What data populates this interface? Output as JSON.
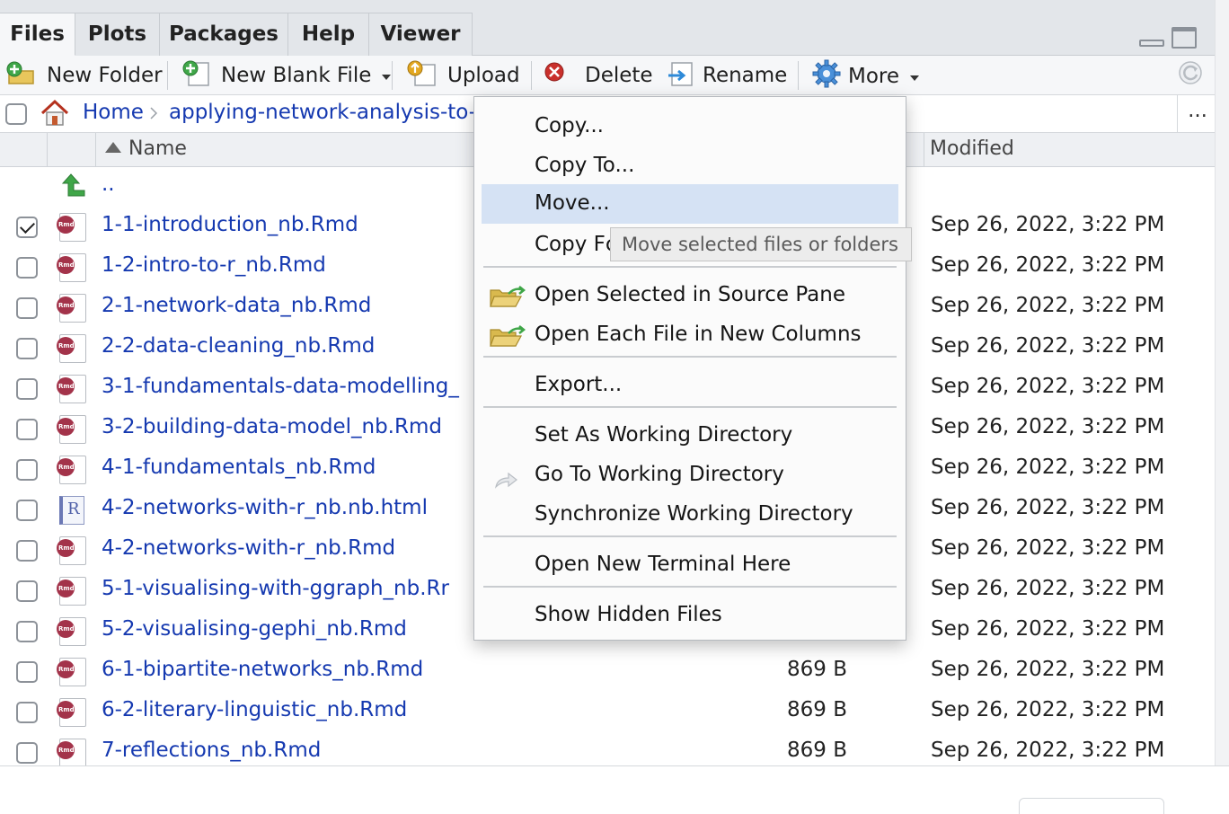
{
  "tabs": [
    {
      "label": "Files",
      "active": true
    },
    {
      "label": "Plots"
    },
    {
      "label": "Packages"
    },
    {
      "label": "Help"
    },
    {
      "label": "Viewer"
    }
  ],
  "toolbar": {
    "new_folder": "New Folder",
    "new_blank_file": "New Blank File",
    "upload": "Upload",
    "delete": "Delete",
    "rename": "Rename",
    "more": "More"
  },
  "path": {
    "home": "Home",
    "folder": "applying-network-analysis-to-",
    "overflow": "..."
  },
  "columns": {
    "name": "Name",
    "modified": "Modified"
  },
  "parent_dir": "..",
  "files": [
    {
      "name": "1-1-introduction_nb.Rmd",
      "size": "",
      "modified": "Sep 26, 2022, 3:22 PM",
      "checked": true,
      "type": "rmd"
    },
    {
      "name": "1-2-intro-to-r_nb.Rmd",
      "size": "",
      "modified": "Sep 26, 2022, 3:22 PM",
      "type": "rmd"
    },
    {
      "name": "2-1-network-data_nb.Rmd",
      "size": "",
      "modified": "Sep 26, 2022, 3:22 PM",
      "type": "rmd"
    },
    {
      "name": "2-2-data-cleaning_nb.Rmd",
      "size": "",
      "modified": "Sep 26, 2022, 3:22 PM",
      "type": "rmd"
    },
    {
      "name": "3-1-fundamentals-data-modelling_",
      "size": "",
      "modified": "Sep 26, 2022, 3:22 PM",
      "type": "rmd"
    },
    {
      "name": "3-2-building-data-model_nb.Rmd",
      "size": "",
      "modified": "Sep 26, 2022, 3:22 PM",
      "type": "rmd"
    },
    {
      "name": "4-1-fundamentals_nb.Rmd",
      "size": "",
      "modified": "Sep 26, 2022, 3:22 PM",
      "type": "rmd"
    },
    {
      "name": "4-2-networks-with-r_nb.nb.html",
      "size": "",
      "modified": "Sep 26, 2022, 3:22 PM",
      "type": "html"
    },
    {
      "name": "4-2-networks-with-r_nb.Rmd",
      "size": "",
      "modified": "Sep 26, 2022, 3:22 PM",
      "type": "rmd"
    },
    {
      "name": "5-1-visualising-with-ggraph_nb.Rr",
      "size": "",
      "modified": "Sep 26, 2022, 3:22 PM",
      "type": "rmd"
    },
    {
      "name": "5-2-visualising-gephi_nb.Rmd",
      "size": "",
      "modified": "Sep 26, 2022, 3:22 PM",
      "type": "rmd"
    },
    {
      "name": "6-1-bipartite-networks_nb.Rmd",
      "size": "869 B",
      "modified": "Sep 26, 2022, 3:22 PM",
      "type": "rmd"
    },
    {
      "name": "6-2-literary-linguistic_nb.Rmd",
      "size": "869 B",
      "modified": "Sep 26, 2022, 3:22 PM",
      "type": "rmd"
    },
    {
      "name": "7-reflections_nb.Rmd",
      "size": "869 B",
      "modified": "Sep 26, 2022, 3:22 PM",
      "type": "rmd"
    }
  ],
  "menu": {
    "copy": "Copy...",
    "copy_to": "Copy To...",
    "move": "Move...",
    "copy_folder": "Copy Fc",
    "open_selected": "Open Selected in Source Pane",
    "open_each": "Open Each File in New Columns",
    "export": "Export...",
    "set_wd": "Set As Working Directory",
    "go_wd": "Go To Working Directory",
    "sync_wd": "Synchronize Working Directory",
    "terminal": "Open New Terminal Here",
    "hidden": "Show Hidden Files"
  },
  "tooltip": "Move selected files or folders",
  "colors": {
    "link": "#1539b0",
    "highlight": "#d5e2f4",
    "tabbar": "#e3e6ea"
  }
}
